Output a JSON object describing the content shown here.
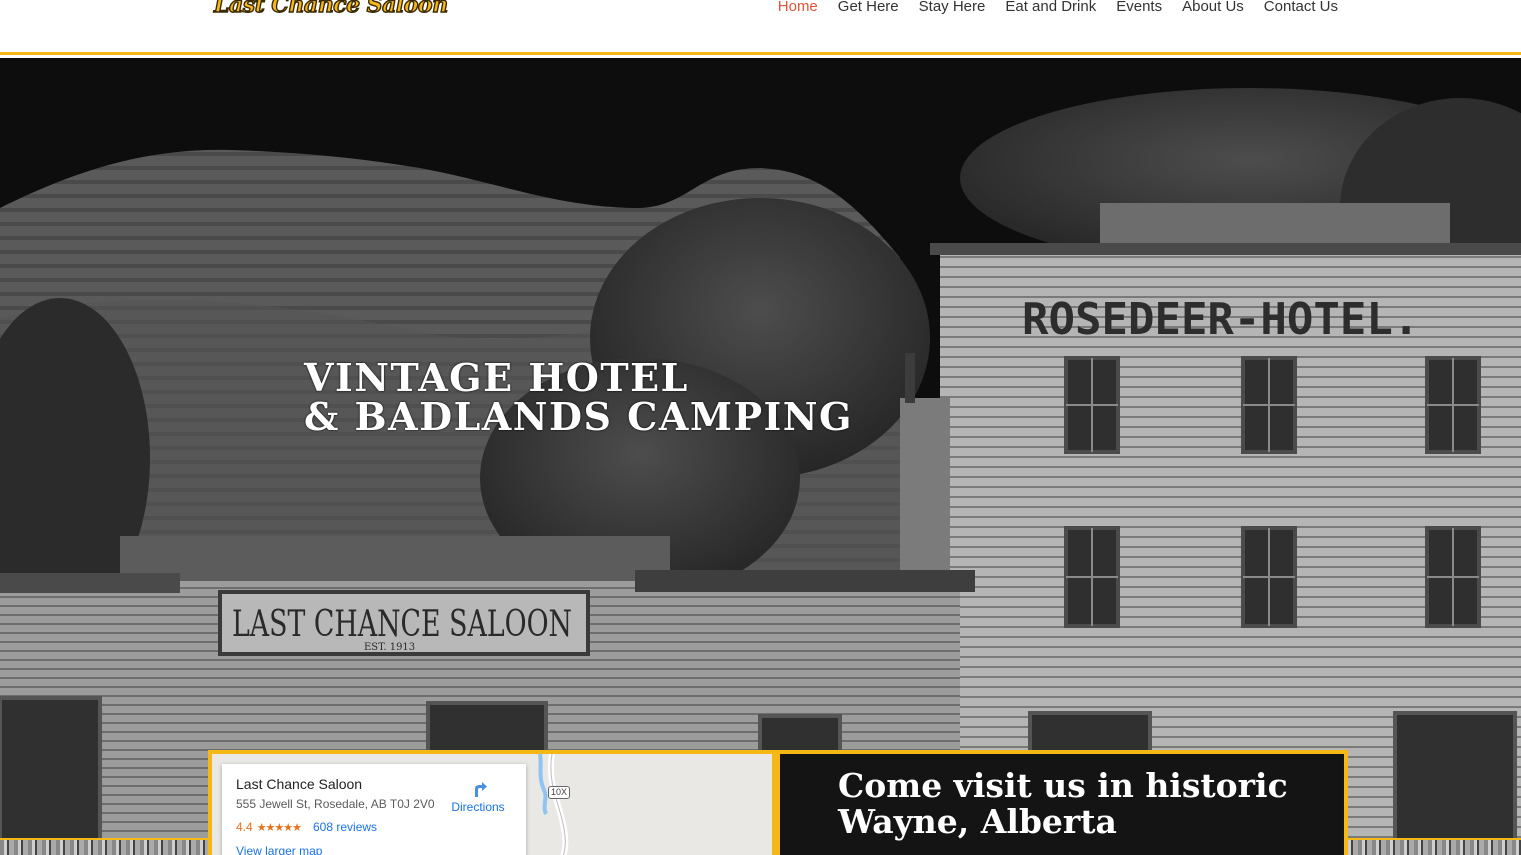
{
  "logo": {
    "text": "Last Chance Saloon"
  },
  "nav": {
    "items": [
      {
        "label": "Home",
        "active": true
      },
      {
        "label": "Get Here",
        "active": false
      },
      {
        "label": "Stay Here",
        "active": false
      },
      {
        "label": "Eat and Drink",
        "active": false
      },
      {
        "label": "Events",
        "active": false
      },
      {
        "label": "About Us",
        "active": false
      },
      {
        "label": "Contact Us",
        "active": false
      }
    ]
  },
  "hero": {
    "title_line1": "VINTAGE HOTEL",
    "title_line2": "& BADLANDS CAMPING",
    "sign_hotel": "ROSEDEER-HOTEL.",
    "sign_saloon": "LAST CHANCE SALOON",
    "sign_saloon_est": "EST. 1913"
  },
  "map": {
    "place_name": "Last Chance Saloon",
    "address": "555 Jewell St, Rosedale, AB T0J 2V0",
    "rating": "4.4",
    "stars": "★★★★★",
    "reviews": "608 reviews",
    "larger_map": "View larger map",
    "directions": "Directions",
    "highway": "10X"
  },
  "visit": {
    "heading_line1": "Come visit us in historic",
    "heading_line2": "Wayne, Alberta"
  },
  "colors": {
    "accent": "#f6b817",
    "nav_active": "#e1533b",
    "panel_bg": "#141414",
    "link": "#1a73e8"
  }
}
